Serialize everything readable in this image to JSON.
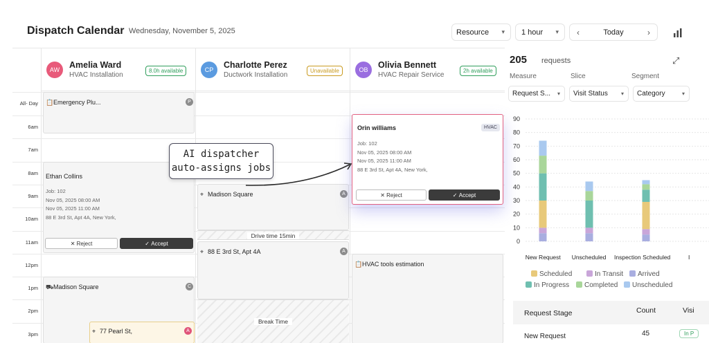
{
  "header": {
    "title": "Dispatch Calendar",
    "date": "Wednesday, November 5, 2025",
    "resource_label": "Resource",
    "interval_label": "1 hour",
    "today_label": "Today"
  },
  "times": [
    "All- Day",
    "6am",
    "7am",
    "8am",
    "9am",
    "10am",
    "11am",
    "12pm",
    "1pm",
    "2pm",
    "3pm"
  ],
  "technicians": [
    {
      "initials": "AW",
      "name": "Amelia Ward",
      "role": "HVAC Installation",
      "availability": "8.0h available",
      "avatar_color": "#e85a7a",
      "badge_color": "#2f9e5b"
    },
    {
      "initials": "CP",
      "name": "Charlotte Perez",
      "role": "Ductwork Installation",
      "availability": "Unavailable",
      "avatar_color": "#5b9be0",
      "badge_color": "#c99a1f"
    },
    {
      "initials": "OB",
      "name": "Olivia Bennett",
      "role": "HVAC Repair Service",
      "availability": "2h available",
      "avatar_color": "#9a6ee0",
      "badge_color": "#2f9e5b"
    }
  ],
  "cards": {
    "emergency": {
      "title": "Emergency Plu...",
      "badge": "P"
    },
    "ethan": {
      "name": "Ethan Collins",
      "job": "Job: 102",
      "start": "Nov 05, 2025 08:00 AM",
      "end": "Nov 05, 2025 11:00 AM",
      "address": "88 E 3rd St, Apt 4A, New York,",
      "reject": "Reject",
      "accept": "Accept"
    },
    "madison1": {
      "title": "Madison Square",
      "badge": "C"
    },
    "pearl": {
      "title": "77 Pearl St,",
      "badge": "A"
    },
    "madison2": {
      "title": "Madison Square",
      "badge": "A"
    },
    "e3rd": {
      "title": "88 E 3rd St, Apt 4A",
      "badge": "A"
    },
    "drive_time": "Drive time 15min",
    "break_time": "Break Time",
    "orin": {
      "name": "Orin williams",
      "tag": "HVAC",
      "job": "Job: 102",
      "start": "Nov 05, 2025 08:00 AM",
      "end": "Nov 05, 2025 11:00 AM",
      "address": "88 E 3rd St, Apt 4A, New York,",
      "reject": "Reject",
      "accept": "Accept"
    },
    "hvac_tools": {
      "title": "HVAC tools estimation"
    }
  },
  "callout": {
    "line1": "AI dispatcher",
    "line2": "auto-assigns jobs"
  },
  "panel": {
    "count": "205",
    "count_label": "requests",
    "filters": [
      {
        "label": "Measure",
        "value": "Request S..."
      },
      {
        "label": "Slice",
        "value": "Visit Status"
      },
      {
        "label": "Segment",
        "value": "Category"
      }
    ],
    "table": {
      "headers": [
        "Request Stage",
        "Count",
        "Visi"
      ],
      "rows": [
        {
          "stage": "New Request",
          "count": "45",
          "status": "In P"
        }
      ]
    }
  },
  "colors": {
    "Scheduled": "#e8c97a",
    "In Transit": "#c9a6d9",
    "Arrived": "#a9aee0",
    "In Progress": "#6fbfb0",
    "Completed": "#a9d69a",
    "Unscheduled": "#a9c9ef"
  },
  "chart_data": {
    "type": "bar",
    "stacked": true,
    "categories": [
      "New Request",
      "Unscheduled",
      "Inspection Scheduled",
      "I"
    ],
    "ylim": [
      0,
      90
    ],
    "yticks": [
      0,
      10,
      20,
      30,
      40,
      50,
      60,
      70,
      80,
      90
    ],
    "series": [
      {
        "name": "Arrived",
        "values": [
          6,
          6,
          5,
          0
        ]
      },
      {
        "name": "In Transit",
        "values": [
          4,
          4,
          4,
          0
        ]
      },
      {
        "name": "Scheduled",
        "values": [
          20,
          0,
          20,
          0
        ]
      },
      {
        "name": "In Progress",
        "values": [
          20,
          20,
          9,
          0
        ]
      },
      {
        "name": "Completed",
        "values": [
          13,
          7,
          4,
          0
        ]
      },
      {
        "name": "Unscheduled",
        "values": [
          11,
          7,
          3,
          0
        ]
      }
    ],
    "legend": [
      "Scheduled",
      "In Transit",
      "Arrived",
      "In Progress",
      "Completed",
      "Unscheduled"
    ],
    "grid": true
  }
}
